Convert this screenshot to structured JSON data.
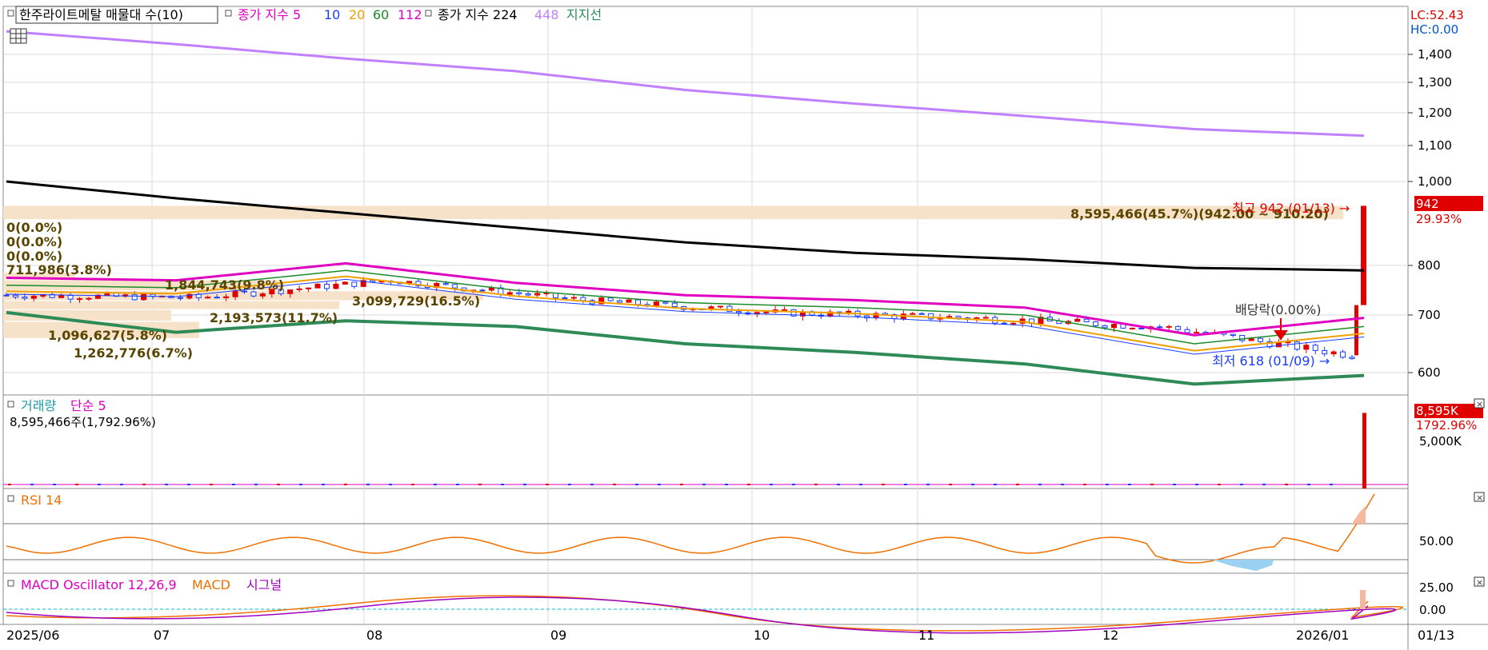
{
  "main_panel": {
    "legend": [
      {
        "text": "한주라이트메탈 매물대 수(10)",
        "color": "#000000",
        "boxed": true
      },
      {
        "text": "종가 지수 5",
        "color": "#e000c0"
      },
      {
        "text": "10",
        "color": "#1a3cff"
      },
      {
        "text": "20",
        "color": "#f0a000"
      },
      {
        "text": "60",
        "color": "#1a8a2a"
      },
      {
        "text": "112",
        "color": "#e000c0"
      },
      {
        "text": "종가 지수 224",
        "color": "#000000"
      },
      {
        "text": "448",
        "color": "#c080ff"
      },
      {
        "text": "지지선",
        "color": "#2e8b57"
      }
    ],
    "lc_label": "LC:52.43",
    "hc_label": "HC:0.00",
    "price_ticks": [
      "1,400",
      "1,300",
      "1,200",
      "1,100",
      "1,000",
      "800",
      "700",
      "600"
    ],
    "current_price": "942",
    "current_change": "29.93%",
    "volume_profile": [
      {
        "label": "8,595,466(45.7%)(942.00 ~ 910.20)",
        "share": 45.7
      },
      {
        "label": "0(0.0%)",
        "share": 0
      },
      {
        "label": "0(0.0%)",
        "share": 0
      },
      {
        "label": "0(0.0%)",
        "share": 0
      },
      {
        "label": "711,986(3.8%)",
        "share": 3.8
      },
      {
        "label": "1,844,743(9.8%)",
        "share": 9.8
      },
      {
        "label": "3,099,729(16.5%)",
        "share": 16.5
      },
      {
        "label": "2,193,573(11.7%)",
        "share": 11.7
      },
      {
        "label": "1,096,627(5.8%)",
        "share": 5.8
      },
      {
        "label": "1,262,776(6.7%)",
        "share": 6.7
      }
    ],
    "annotations": {
      "high": "최고 942 (01/13) →",
      "low": "최저 618 (01/09) →",
      "dividend": "배당락(0.00%)"
    }
  },
  "volume_panel": {
    "legend": [
      {
        "text": "거래량",
        "color": "#1a9aaa"
      },
      {
        "text": "단순 5",
        "color": "#e000c0"
      }
    ],
    "info": "8,595,466주(1,792.96%)",
    "last_value": "8,595K",
    "last_change": "1792.96%",
    "tick": "5,000K"
  },
  "rsi_panel": {
    "legend": [
      {
        "text": "RSI 14",
        "color": "#f07000"
      }
    ],
    "tick": "50.00"
  },
  "macd_panel": {
    "legend": [
      {
        "text": "MACD Oscillator 12,26,9",
        "color": "#e000c0"
      },
      {
        "text": "MACD",
        "color": "#f07000"
      },
      {
        "text": "시그널",
        "color": "#a000c0"
      }
    ],
    "ticks": [
      "25.00",
      "0.00"
    ]
  },
  "x_axis": {
    "labels": [
      "2025/06",
      "07",
      "08",
      "09",
      "10",
      "11",
      "12",
      "2026/01"
    ],
    "last_date": "01/13"
  },
  "chart_data": {
    "type": "line",
    "title": "한주라이트메탈",
    "x": [
      "2025/06",
      "07",
      "08",
      "09",
      "10",
      "11",
      "12",
      "2026/01",
      "01/13"
    ],
    "ylim": [
      560,
      1520
    ],
    "series": [
      {
        "name": "종가",
        "values": [
          740,
          735,
          770,
          730,
          705,
          695,
          680,
          630,
          942
        ]
      },
      {
        "name": "종가 지수 224",
        "values": [
          1000,
          960,
          925,
          890,
          855,
          830,
          815,
          795,
          790
        ]
      },
      {
        "name": "448",
        "values": [
          1490,
          1440,
          1385,
          1340,
          1275,
          1230,
          1190,
          1150,
          1130
        ]
      },
      {
        "name": "지지선",
        "values": [
          705,
          670,
          690,
          680,
          650,
          635,
          615,
          580,
          595
        ]
      }
    ],
    "high": 942,
    "low": 618,
    "volume_profile_levels": [
      {
        "range": [
          910.2,
          942.0
        ],
        "volume": 8595466,
        "pct": 45.7
      },
      {
        "volume": 711986,
        "pct": 3.8
      },
      {
        "volume": 1844743,
        "pct": 9.8
      },
      {
        "volume": 3099729,
        "pct": 16.5
      },
      {
        "volume": 2193573,
        "pct": 11.7
      },
      {
        "volume": 1096627,
        "pct": 5.8
      },
      {
        "volume": 1262776,
        "pct": 6.7
      }
    ],
    "last_volume": 8595466,
    "last_volume_change_pct": 1792.96
  }
}
